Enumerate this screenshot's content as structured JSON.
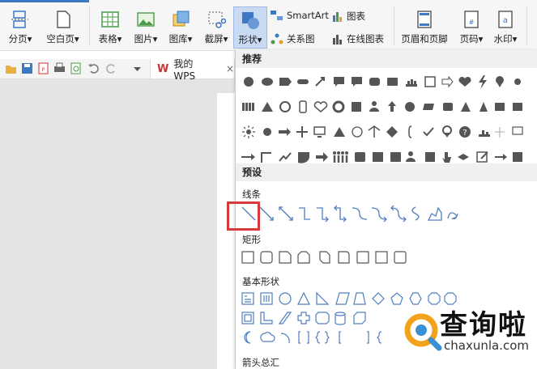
{
  "ribbon": {
    "buttons": [
      {
        "label": "分页",
        "arrow": "▾"
      },
      {
        "label": "空白页",
        "arrow": "▾"
      },
      {
        "label": "表格",
        "arrow": "▾"
      },
      {
        "label": "图片",
        "arrow": "▾"
      },
      {
        "label": "图库",
        "arrow": "▾"
      },
      {
        "label": "截屏",
        "arrow": "▾"
      },
      {
        "label": "形状",
        "arrow": "▾"
      },
      {
        "label": "页眉和页脚",
        "arrow": ""
      },
      {
        "label": "页码",
        "arrow": "▾"
      },
      {
        "label": "水印",
        "arrow": "▾"
      }
    ],
    "smartart": "SmartArt",
    "chart": "图表",
    "relation": "关系图",
    "online_chart": "在线图表"
  },
  "quick_access": {
    "tab_label": "我的WPS",
    "close": "×"
  },
  "panel": {
    "recommended": "推荐",
    "presets": "预设",
    "sections": {
      "lines": "线条",
      "rect": "矩形",
      "basic": "基本形状",
      "arrows": "箭头总汇"
    }
  },
  "watermark": {
    "brand": "查询啦",
    "domain": "chaxunla.com"
  },
  "colors": {
    "accent": "#3c78c3",
    "highlight": "#d63a3a",
    "shape_fill": "#555555",
    "outline": "#4f7fbf"
  }
}
